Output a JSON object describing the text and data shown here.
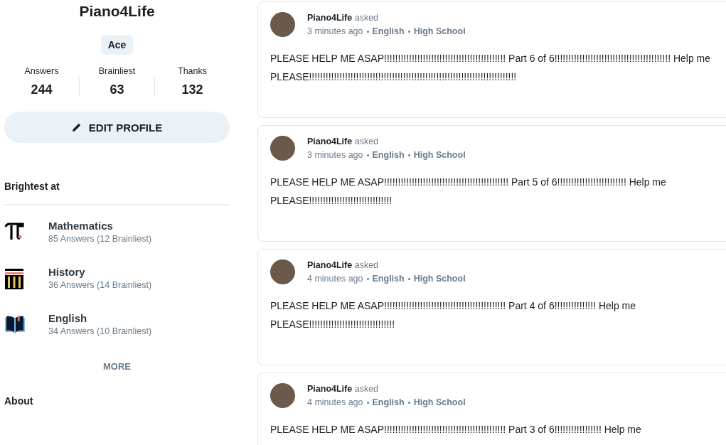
{
  "profile": {
    "username": "Piano4Life",
    "rank": "Ace",
    "stats": [
      {
        "label": "Answers",
        "value": "244"
      },
      {
        "label": "Brainliest",
        "value": "63"
      },
      {
        "label": "Thanks",
        "value": "132"
      }
    ],
    "edit_button": "EDIT PROFILE"
  },
  "brightest_at": {
    "title": "Brightest at",
    "subjects": [
      {
        "kind": "math",
        "name": "Mathematics",
        "detail": "85 Answers (12 Brainliest)"
      },
      {
        "kind": "history",
        "name": "History",
        "detail": "36 Answers (14 Brainliest)"
      },
      {
        "kind": "english",
        "name": "English",
        "detail": "34 Answers (10 Brainliest)"
      }
    ],
    "more": "MORE"
  },
  "about": {
    "title": "About"
  },
  "questions": [
    {
      "author": "Piano4Life",
      "verb": "asked",
      "time": "3 minutes ago",
      "subject": "English",
      "level": "High School",
      "text": "PLEASE HELP ME ASAP!!!!!!!!!!!!!!!!!!!!!!!!!!!!!!!!!!!!!!!!!!!! Part 6 of 6!!!!!!!!!!!!!!!!!!!!!!!!!!!!!!!!!!!!!!!!!! Help me PLEASE!!!!!!!!!!!!!!!!!!!!!!!!!!!!!!!!!!!!!!!!!!!!!!!!!!!!!!!!!!!!!!!!!!!!!!!!!!!"
    },
    {
      "author": "Piano4Life",
      "verb": "asked",
      "time": "3 minutes ago",
      "subject": "English",
      "level": "High School",
      "text": "PLEASE HELP ME ASAP!!!!!!!!!!!!!!!!!!!!!!!!!!!!!!!!!!!!!!!!!!!!! Part 5 of 6!!!!!!!!!!!!!!!!!!!!!!!!! Help me PLEASE!!!!!!!!!!!!!!!!!!!!!!!!!!!!!!"
    },
    {
      "author": "Piano4Life",
      "verb": "asked",
      "time": "4 minutes ago",
      "subject": "English",
      "level": "High School",
      "text": "PLEASE HELP ME ASAP!!!!!!!!!!!!!!!!!!!!!!!!!!!!!!!!!!!!!!!!!!!! Part 4 of 6!!!!!!!!!!!!!!! Help me PLEASE!!!!!!!!!!!!!!!!!!!!!!!!!!!!!!!"
    },
    {
      "author": "Piano4Life",
      "verb": "asked",
      "time": "4 minutes ago",
      "subject": "English",
      "level": "High School",
      "text": "PLEASE HELP ME ASAP!!!!!!!!!!!!!!!!!!!!!!!!!!!!!!!!!!!!!!!!!!!! Part 3 of 6!!!!!!!!!!!!!!!!! Help me"
    }
  ]
}
